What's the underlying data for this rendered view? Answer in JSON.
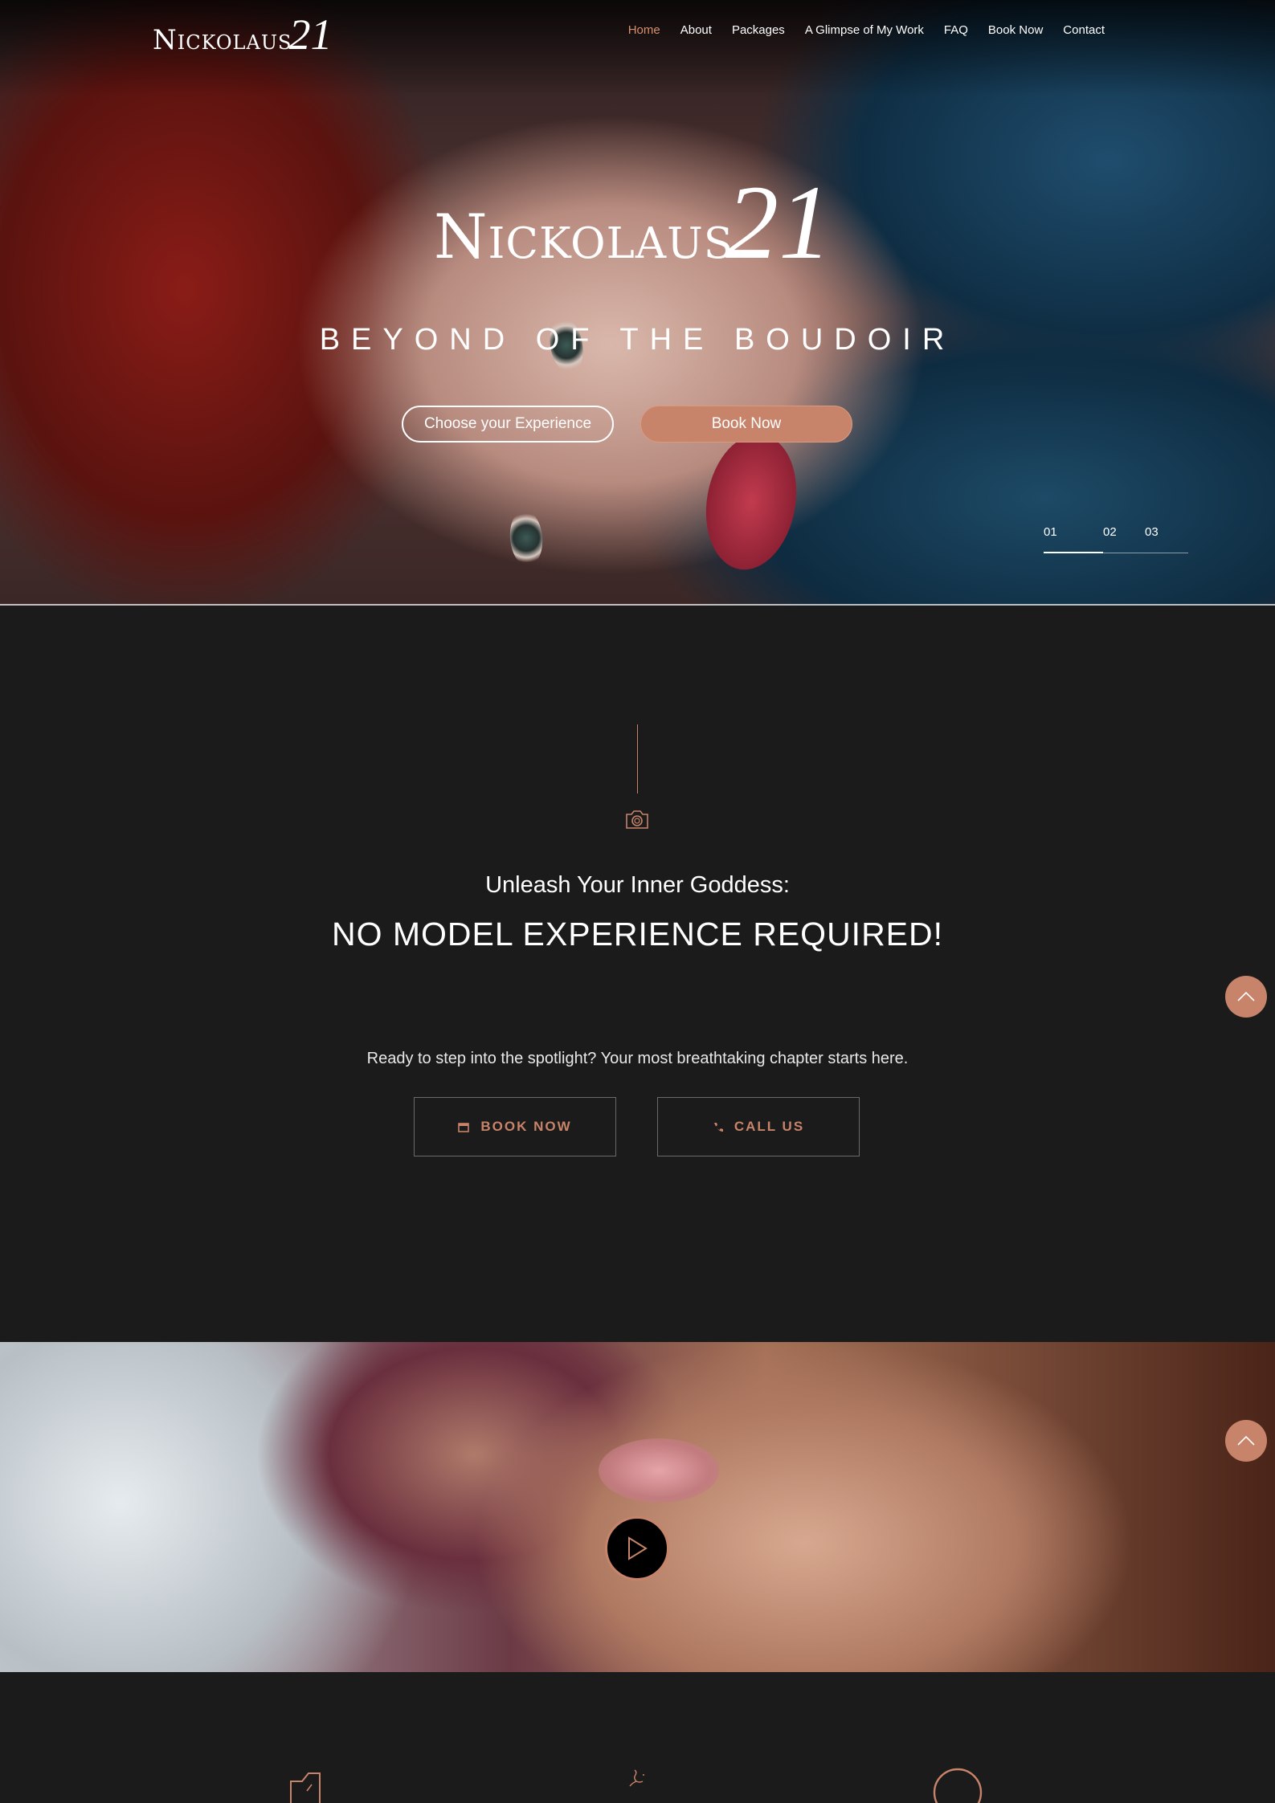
{
  "brand": {
    "name": "Nickolaus",
    "number": "21"
  },
  "nav": {
    "items": [
      {
        "label": "Home",
        "active": true
      },
      {
        "label": "About"
      },
      {
        "label": "Packages"
      },
      {
        "label": "A Glimpse of My Work"
      },
      {
        "label": "FAQ"
      },
      {
        "label": "Book Now"
      },
      {
        "label": "Contact"
      }
    ]
  },
  "hero": {
    "tagline": "BEYOND OF THE BOUDOIR",
    "choose_label": "Choose your Experience",
    "book_label": "Book Now",
    "slides": [
      "01",
      "02",
      "03"
    ],
    "active_slide": 1
  },
  "intro": {
    "subtitle": "Unleash Your Inner Goddess:",
    "title": "NO MODEL EXPERIENCE REQUIRED!",
    "text": "Ready to step into the spotlight? Your most breathtaking chapter starts here.",
    "book_now_label": "BOOK NOW",
    "call_us_label": "CALL US"
  },
  "icons": {
    "camera": "camera-icon",
    "calendar": "calendar-icon",
    "phone": "phone-icon",
    "scroll_top": "chevron-up-icon",
    "play": "play-icon"
  },
  "colors": {
    "accent": "#c8846a",
    "nav_active": "#d7906e",
    "background": "#1b1b1b"
  }
}
